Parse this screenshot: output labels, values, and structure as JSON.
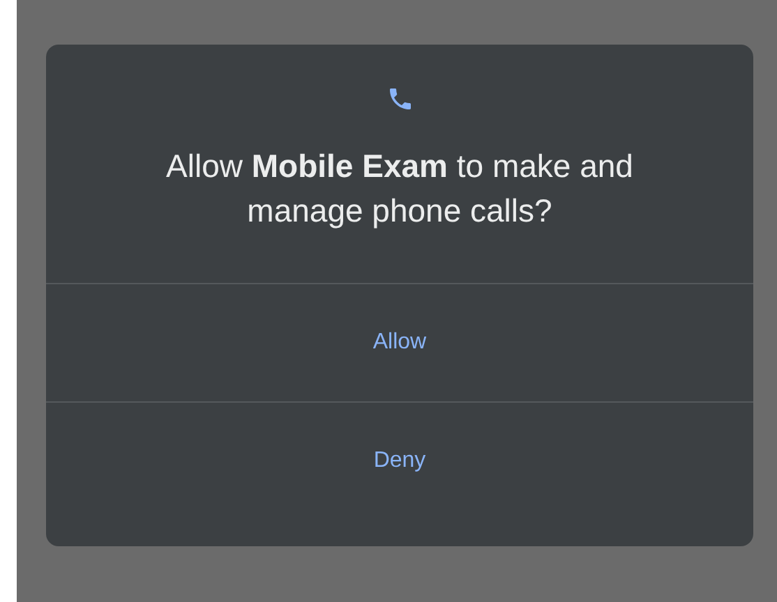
{
  "dialog": {
    "message": "Allow **Mobile Exam** to make and manage phone calls?",
    "buttons": [
      {
        "label": "Allow"
      },
      {
        "label": "Deny"
      }
    ]
  }
}
